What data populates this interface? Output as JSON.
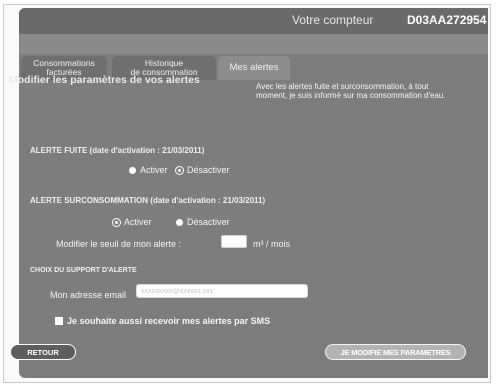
{
  "header": {
    "counter_label": "Votre compteur",
    "counter_value": "D03AA272954"
  },
  "tabs": [
    {
      "line1": "Consommations",
      "line2": "facturées"
    },
    {
      "line1": "Historique",
      "line2": "de consommation"
    },
    {
      "line1": "Mes alertes",
      "line2": ""
    }
  ],
  "section_title": "Modifier les paramètres de vos alertes",
  "info_text": "Avec les alertes fuite et surconsommation, à tout moment, je suis informé sur ma consommation d'eau.",
  "leak_alert": {
    "title": "ALERTE FUITE (date d'activation : 21/03/2011)",
    "activate_label": "Activer",
    "deactivate_label": "Désactiver",
    "selected": "Désactiver"
  },
  "overuse_alert": {
    "title": "ALERTE SURCONSOMMATION (date d'activation : 21/03/2011)",
    "activate_label": "Activer",
    "deactivate_label": "Désactiver",
    "selected": "Activer",
    "threshold_label": "Modifier le seuil de mon alerte :",
    "threshold_value": "",
    "threshold_unit": "m³ / mois"
  },
  "support": {
    "title": "CHOIX DU SUPPORT D'ALERTE",
    "email_label": "Mon adresse email",
    "email_value": "xxxxxxxxx@xxxxxx.xxx",
    "sms_label": "Je souhaite aussi recevoir mes alertes par SMS"
  },
  "buttons": {
    "back": "RETOUR",
    "submit": "JE MODIFIE MES PARAMETRES"
  }
}
